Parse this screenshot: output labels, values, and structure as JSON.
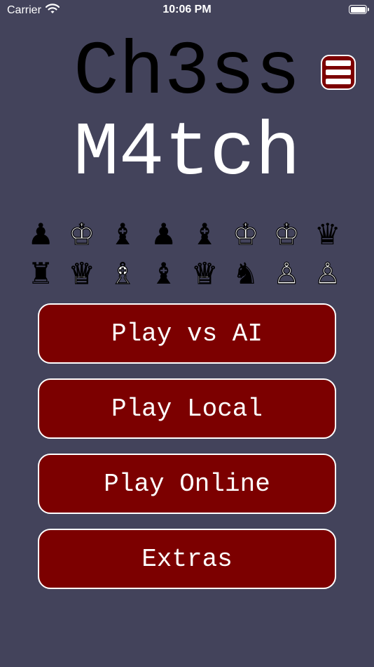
{
  "status_bar": {
    "carrier": "Carrier",
    "time": "10:06 PM",
    "battery_level": 1.0
  },
  "title": {
    "line1": "Ch3ss",
    "line2": "M4tch"
  },
  "menu_icon": "hamburger-menu-icon",
  "pieces": {
    "row1": [
      {
        "glyph": "♟",
        "color": "black",
        "name": "pawn"
      },
      {
        "glyph": "♔",
        "color": "white",
        "name": "king"
      },
      {
        "glyph": "♝",
        "color": "black",
        "name": "bishop"
      },
      {
        "glyph": "♟",
        "color": "black",
        "name": "pawn"
      },
      {
        "glyph": "♝",
        "color": "black",
        "name": "bishop"
      },
      {
        "glyph": "♔",
        "color": "white",
        "name": "king"
      },
      {
        "glyph": "♔",
        "color": "white",
        "name": "king"
      },
      {
        "glyph": "♛",
        "color": "black",
        "name": "queen"
      }
    ],
    "row2": [
      {
        "glyph": "♜",
        "color": "black",
        "name": "rook"
      },
      {
        "glyph": "♕",
        "color": "white",
        "name": "queen"
      },
      {
        "glyph": "♗",
        "color": "white",
        "name": "bishop"
      },
      {
        "glyph": "♝",
        "color": "black",
        "name": "bishop"
      },
      {
        "glyph": "♕",
        "color": "white",
        "name": "queen"
      },
      {
        "glyph": "♞",
        "color": "black",
        "name": "knight"
      },
      {
        "glyph": "♙",
        "color": "white",
        "name": "pawn"
      },
      {
        "glyph": "♙",
        "color": "white",
        "name": "pawn"
      }
    ]
  },
  "buttons": {
    "play_ai": "Play vs AI",
    "play_local": "Play Local",
    "play_online": "Play Online",
    "extras": "Extras"
  },
  "colors": {
    "background": "#43435b",
    "button": "#7c0000",
    "button_border": "#ffffff"
  }
}
